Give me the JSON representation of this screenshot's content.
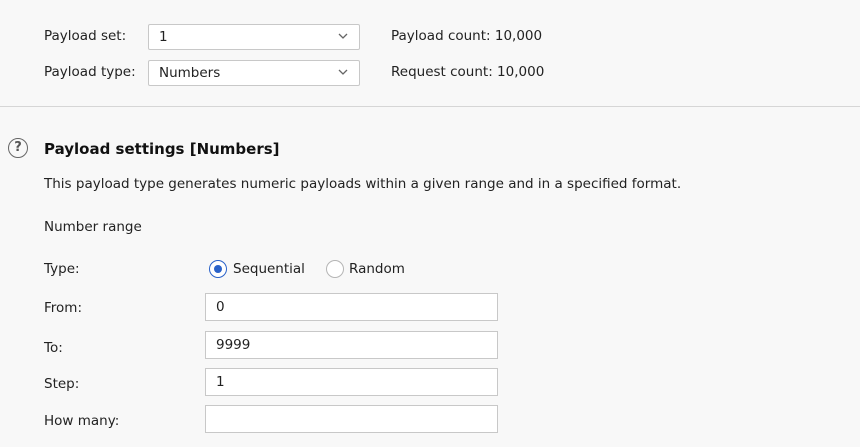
{
  "payload_set": {
    "label": "Payload set:",
    "value": "1",
    "count_label": "Payload count: 10,000"
  },
  "payload_type": {
    "label": "Payload type:",
    "value": "Numbers",
    "count_label": "Request count: 10,000"
  },
  "settings": {
    "title": "Payload settings [Numbers]",
    "description": "This payload type generates numeric payloads within a given range and in a specified format.",
    "section_label": "Number range",
    "type_label": "Type:",
    "options": [
      "Sequential",
      "Random"
    ],
    "selected": "Sequential",
    "from_label": "From:",
    "from_value": "0",
    "to_label": "To:",
    "to_value": "9999",
    "step_label": "Step:",
    "step_value": "1",
    "how_many_label": "How many:",
    "how_many_value": ""
  },
  "icons": {
    "help": "?",
    "accent_color": "#2a62c9"
  }
}
